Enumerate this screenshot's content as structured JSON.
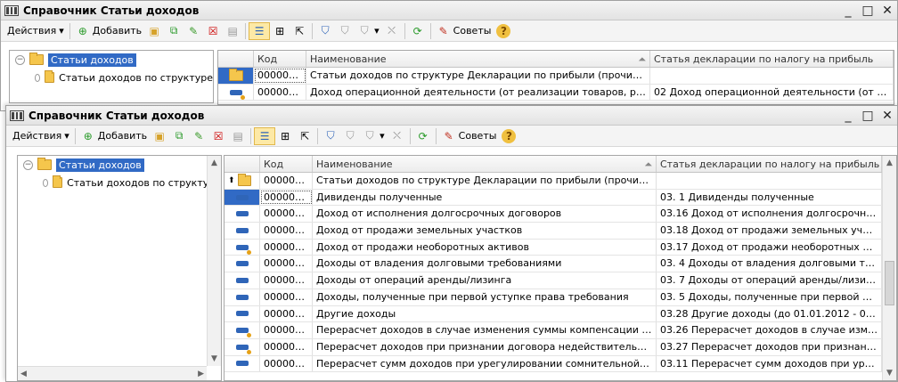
{
  "window_title": "Справочник Статьи доходов",
  "window_buttons": {
    "minimize": "_",
    "maximize": "□",
    "close": "✕"
  },
  "toolbar": {
    "actions_label": "Действия",
    "add_label": "Добавить",
    "tips_label": "Советы",
    "help_label": "?"
  },
  "tree": {
    "root_label": "Статьи доходов",
    "child_label": "Статьи доходов по структуре"
  },
  "columns": {
    "code": "Код",
    "name": "Наименование",
    "decl": "Статья декларации по налогу на прибыль"
  },
  "back_window_rows": [
    {
      "code": "000001...",
      "name": "Статьи доходов по структуре Декларации по прибыли (прочие доходы)",
      "decl": "",
      "icon": "folder-icon"
    },
    {
      "code": "000001...",
      "name": "Доход операционной деятельности (от реализации товаров, работ, услуг)",
      "decl": "02 Доход операционной деятельности (от реа...",
      "icon": "element-marked-icon"
    }
  ],
  "front_window_rows": [
    {
      "code": "000001...",
      "name": "Статьи доходов по структуре Декларации по прибыли (прочие доходы)",
      "decl": "",
      "icon": "folder-up-icon"
    },
    {
      "code": "000001...",
      "name": "Дивиденды полученные",
      "decl": "03. 1 Дивиденды полученные",
      "icon": "element-icon"
    },
    {
      "code": "000001...",
      "name": "Доход от исполнения долгосрочных договоров",
      "decl": "03.16 Доход от исполнения долгосрочных дог...",
      "icon": "element-icon"
    },
    {
      "code": "000001...",
      "name": "Доход от продажи земельных участков",
      "decl": "03.18 Доход от продажи земельных участков",
      "icon": "element-icon"
    },
    {
      "code": "000001...",
      "name": "Доход от продажи необоротных активов",
      "decl": "03.17 Доход от продажи необоротных активов",
      "icon": "element-marked-icon"
    },
    {
      "code": "000001...",
      "name": "Доходы от владения долговыми требованиями",
      "decl": "03. 4 Доходы от владения долговыми требова...",
      "icon": "element-icon"
    },
    {
      "code": "000001...",
      "name": "Доходы от операций аренды/лизинга",
      "decl": "03. 7 Доходы от операций аренды/лизинга",
      "icon": "element-icon"
    },
    {
      "code": "000001...",
      "name": "Доходы, полученные при первой уступке права требования",
      "decl": "03. 5 Доходы, полученные при первой уступке...",
      "icon": "element-icon"
    },
    {
      "code": "000001...",
      "name": "Другие доходы",
      "decl": "03.28 Другие доходы (до 01.01.2012 - 03.27)",
      "icon": "element-icon"
    },
    {
      "code": "000001...",
      "name": "Перерасчет доходов в случае изменения суммы компенсации товаров (...",
      "decl": "03.26 Перерасчет доходов в случае изменени...",
      "icon": "element-marked-icon"
    },
    {
      "code": "000001...",
      "name": "Перерасчет доходов при признании договора недействительным",
      "decl": "03.27 Перерасчет доходов при признании дог...",
      "icon": "element-marked-icon"
    },
    {
      "code": "000001...",
      "name": "Перерасчет сумм доходов при урегулировании сомнительной (безнаде...",
      "decl": "03.11 Перерасчет сумм доходов при урегулир...",
      "icon": "element-icon"
    }
  ],
  "colors": {
    "selection": "#316ac5",
    "folder": "#f5c64c",
    "element": "#2f65b8"
  }
}
